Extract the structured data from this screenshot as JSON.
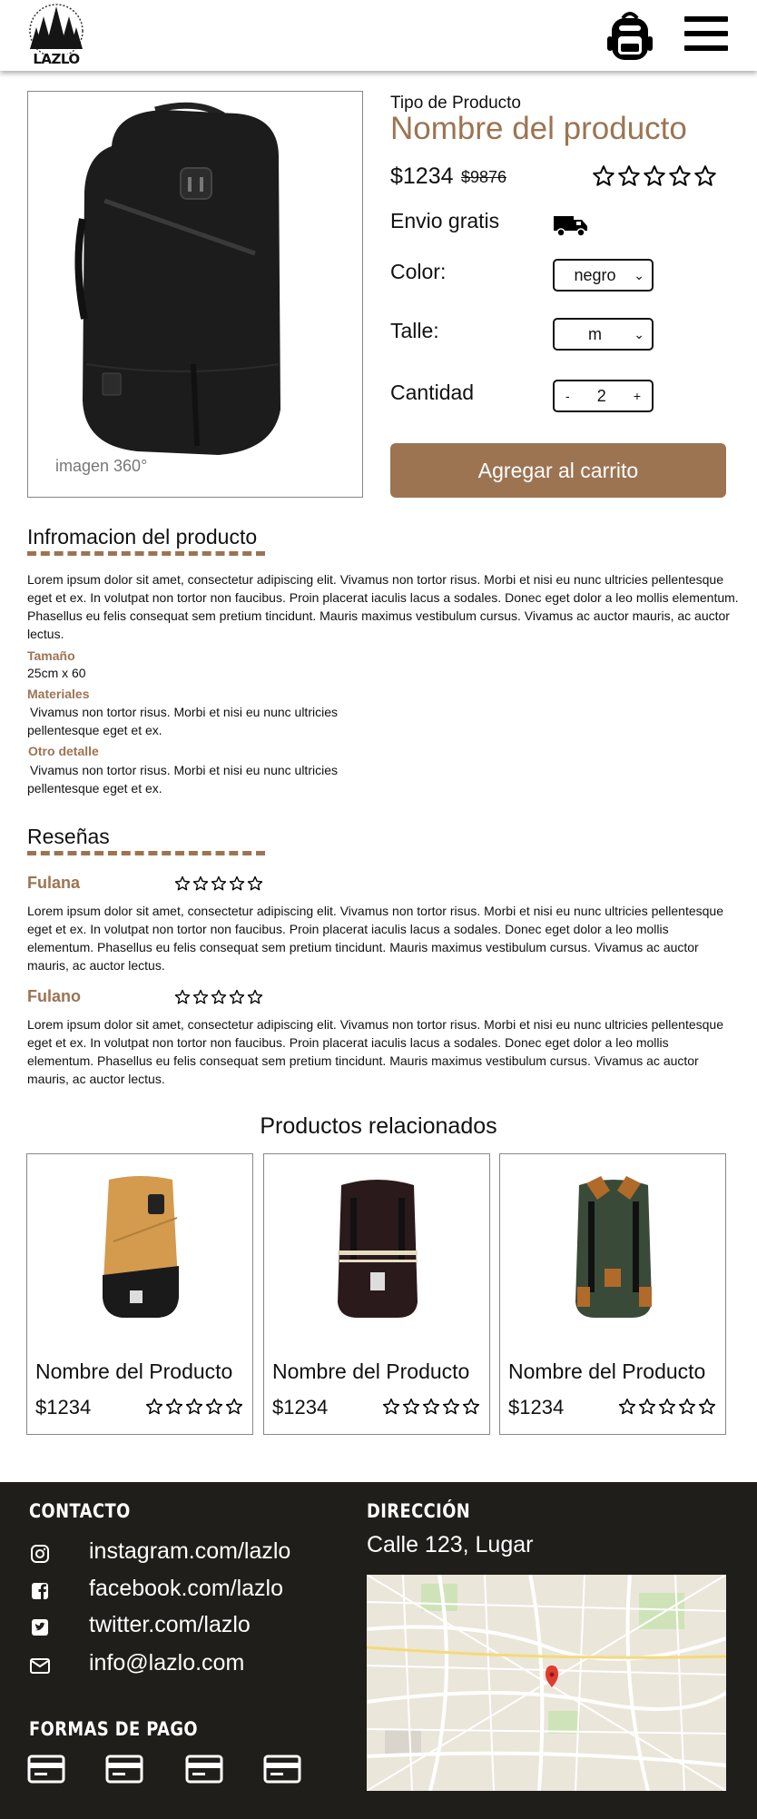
{
  "header": {
    "logo_text": "LAZLO",
    "cart_icon": "backpack-icon",
    "menu_icon": "hamburger-menu-icon"
  },
  "product": {
    "image_caption": "imagen 360°",
    "type": "Tipo de Producto",
    "name": "Nombre del producto",
    "price": "$1234",
    "old_price": "$9876",
    "rating": 0,
    "shipping_label": "Envio gratis",
    "shipping_icon": "truck-icon",
    "color_label": "Color:",
    "color_value": "negro",
    "size_label": "Talle:",
    "size_value": "m",
    "qty_label": "Cantidad",
    "qty_minus": "-",
    "qty_value": "2",
    "qty_plus": "+",
    "add_to_cart": "Agregar al carrito"
  },
  "info": {
    "title": "Infromacion del producto",
    "description": "Lorem ipsum dolor sit amet, consectetur adipiscing elit. Vivamus non tortor risus. Morbi et nisi eu nunc ultricies pellentesque eget et ex. In volutpat non tortor non faucibus. Proin placerat iaculis lacus a sodales. Donec eget dolor a leo mollis elementum. Phasellus eu felis consequat sem pretium tincidunt. Mauris maximus vestibulum cursus. Vivamus ac auctor mauris, ac auctor lectus.",
    "size_label": "Tamaño",
    "size_value": "25cm x 60",
    "materials_label": "Materiales",
    "materials_value": "Vivamus non tortor risus. Morbi et nisi eu nunc ultricies pellentesque eget et ex.",
    "other_label": "Otro detalle",
    "other_value": "Vivamus non tortor risus. Morbi et nisi eu nunc ultricies pellentesque eget et ex."
  },
  "reviews": {
    "title": "Reseñas",
    "items": [
      {
        "name": "Fulana",
        "rating": 0,
        "text": "Lorem ipsum dolor sit amet, consectetur adipiscing elit. Vivamus non tortor risus. Morbi et nisi eu nunc ultricies pellentesque eget et ex. In volutpat non tortor non faucibus. Proin placerat iaculis lacus a sodales. Donec eget dolor a leo mollis elementum. Phasellus eu felis consequat sem pretium tincidunt. Mauris maximus vestibulum cursus. Vivamus ac auctor mauris, ac auctor lectus."
      },
      {
        "name": "Fulano",
        "rating": 0,
        "text": "Lorem ipsum dolor sit amet, consectetur adipiscing elit. Vivamus non tortor risus. Morbi et nisi eu nunc ultricies pellentesque eget et ex. In volutpat non tortor non faucibus. Proin placerat iaculis lacus a sodales. Donec eget dolor a leo mollis elementum. Phasellus eu felis consequat sem pretium tincidunt. Mauris maximus vestibulum cursus. Vivamus ac auctor mauris, ac auctor lectus."
      }
    ]
  },
  "related": {
    "title": "Productos relacionados",
    "items": [
      {
        "name": "Nombre del Producto",
        "price": "$1234",
        "rating": 0,
        "color": "#d49a4e"
      },
      {
        "name": "Nombre del Producto",
        "price": "$1234",
        "rating": 0,
        "color": "#2a1a1c"
      },
      {
        "name": "Nombre del Producto",
        "price": "$1234",
        "rating": 0,
        "color": "#3a4a38"
      }
    ]
  },
  "footer": {
    "contact_title": "CONTACTO",
    "links": [
      {
        "icon": "instagram-icon",
        "text": "instagram.com/lazlo"
      },
      {
        "icon": "facebook-icon",
        "text": "facebook.com/lazlo"
      },
      {
        "icon": "twitter-icon",
        "text": "twitter.com/lazlo"
      },
      {
        "icon": "email-icon",
        "text": "info@lazlo.com"
      }
    ],
    "address_title": "DIRECCIÓN",
    "address": "Calle 123, Lugar",
    "payment_title": "FORMAS DE PAGO",
    "payment_icons": [
      "credit-card-icon",
      "credit-card-icon",
      "credit-card-icon",
      "credit-card-icon"
    ]
  },
  "colors": {
    "accent": "#9c7452",
    "footer_bg": "#1f1e1a"
  }
}
